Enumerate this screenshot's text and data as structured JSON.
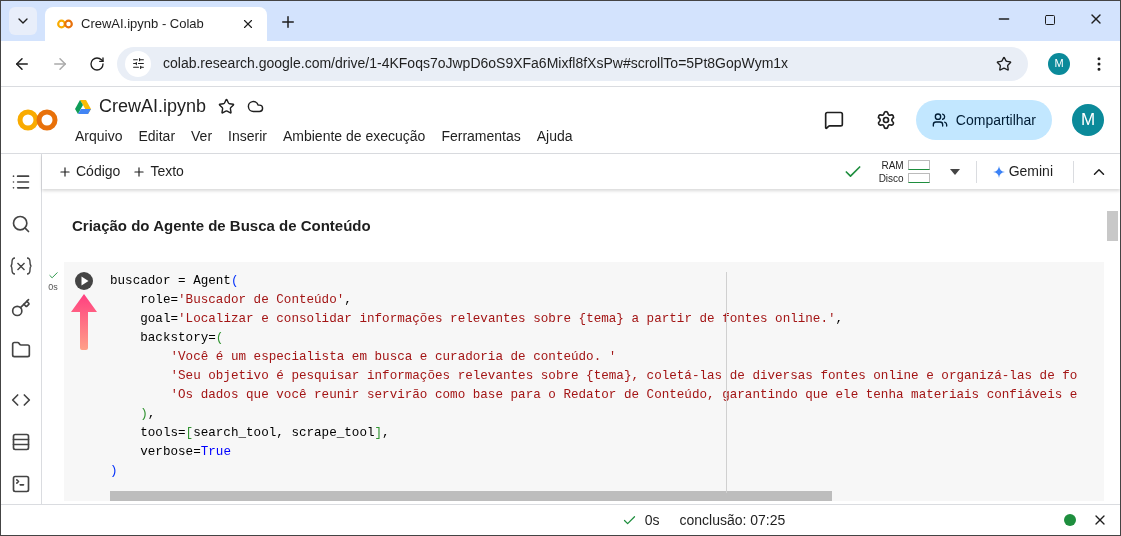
{
  "browser": {
    "tabs": [
      {
        "title": "CrewAI.ipynb - Colab",
        "selected": true
      }
    ],
    "url": "colab.research.google.com/drive/1-4KFoqs7oJwpD6oS9XFa6Mixfl8fXsPw#scrollTo=5Pt8GopWym1x",
    "profile": "M"
  },
  "header": {
    "notebook": "CrewAI.ipynb",
    "menu": [
      "Arquivo",
      "Editar",
      "Ver",
      "Inserir",
      "Ambiente de execução",
      "Ferramentas",
      "Ajuda"
    ],
    "share": "Compartilhar",
    "avatar": "M"
  },
  "toolbar": {
    "add": [
      "Código",
      "Texto"
    ],
    "ram": "RAM",
    "disk": "Disco",
    "gemini": "Gemini"
  },
  "heading": "Criação do Agente de Busca de Conteúdo",
  "cell": {
    "time": "0s",
    "lines": [
      [
        {
          "kind": "plain",
          "text": "buscador = Agent"
        },
        {
          "kind": "bracket",
          "text": "("
        }
      ],
      [
        {
          "kind": "plain",
          "text": "    role="
        },
        {
          "kind": "string",
          "text": "'Buscador de Conteúdo'"
        },
        {
          "kind": "plain",
          "text": ","
        }
      ],
      [
        {
          "kind": "plain",
          "text": "    goal="
        },
        {
          "kind": "string",
          "text": "'Localizar e consolidar informações relevantes sobre {tema} a partir de fontes online.'"
        },
        {
          "kind": "plain",
          "text": ","
        }
      ],
      [
        {
          "kind": "plain",
          "text": "    backstory="
        },
        {
          "kind": "group",
          "text": "("
        }
      ],
      [
        {
          "kind": "string",
          "text": "        'Você é um especialista em busca e curadoria de conteúdo. '"
        }
      ],
      [
        {
          "kind": "string",
          "text": "        'Seu objetivo é pesquisar informações relevantes sobre {tema}, coletá-las de diversas fontes online e organizá-las de fo"
        }
      ],
      [
        {
          "kind": "string",
          "text": "        'Os dados que você reunir servirão como base para o Redator de Conteúdo, garantindo que ele tenha materiais confiáveis e"
        }
      ],
      [
        {
          "kind": "group",
          "text": "    )"
        },
        {
          "kind": "plain",
          "text": ","
        }
      ],
      [
        {
          "kind": "plain",
          "text": "    tools="
        },
        {
          "kind": "group",
          "text": "["
        },
        {
          "kind": "plain",
          "text": "search_tool, scrape_tool"
        },
        {
          "kind": "group",
          "text": "]"
        },
        {
          "kind": "plain",
          "text": ","
        }
      ],
      [
        {
          "kind": "plain",
          "text": "    verbose="
        },
        {
          "kind": "keyword",
          "text": "True"
        }
      ],
      [
        {
          "kind": "bracket",
          "text": ")"
        }
      ]
    ]
  },
  "status_bar": {
    "time": "0s",
    "completed": "conclusão: 07:25"
  }
}
